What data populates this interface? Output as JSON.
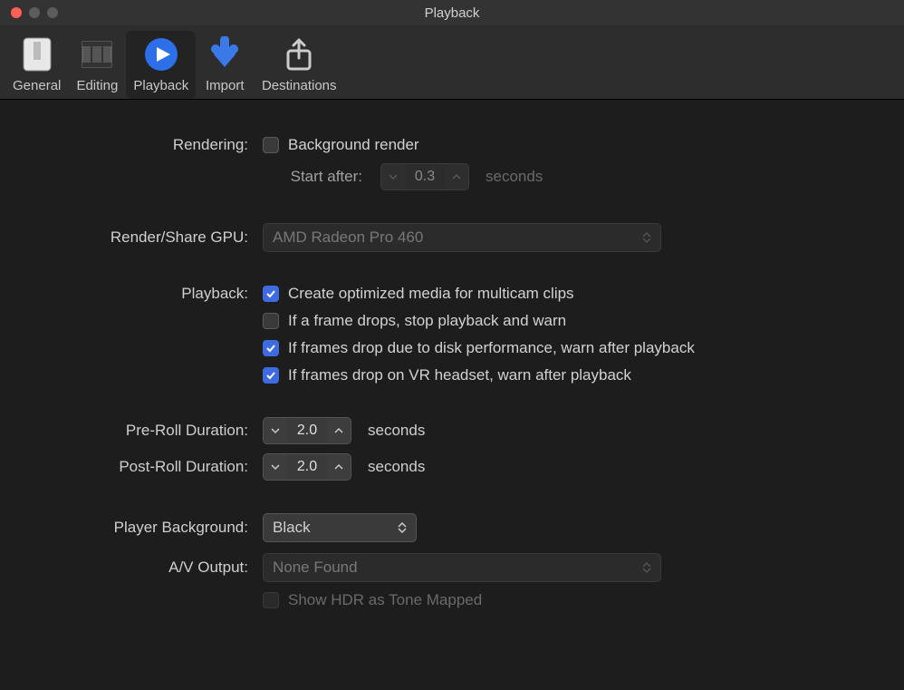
{
  "window": {
    "title": "Playback"
  },
  "toolbar": {
    "general": "General",
    "editing": "Editing",
    "playback": "Playback",
    "import": "Import",
    "destinations": "Destinations"
  },
  "labels": {
    "rendering": "Rendering:",
    "start_after": "Start after:",
    "render_share_gpu": "Render/Share GPU:",
    "playback": "Playback:",
    "pre_roll": "Pre-Roll Duration:",
    "post_roll": "Post-Roll Duration:",
    "player_bg": "Player Background:",
    "av_output": "A/V Output:"
  },
  "checkboxes": {
    "background_render": "Background render",
    "opt_multicam": "Create optimized media for multicam clips",
    "frame_drop_stop": "If a frame drops, stop playback and warn",
    "disk_warn": "If frames drop due to disk performance, warn after playback",
    "vr_warn": "If frames drop on VR headset, warn after playback",
    "hdr_tone": "Show HDR as Tone Mapped"
  },
  "values": {
    "start_after": "0.3",
    "gpu": "AMD Radeon Pro 460",
    "pre_roll": "2.0",
    "post_roll": "2.0",
    "player_bg": "Black",
    "av_output": "None Found"
  },
  "units": {
    "seconds": "seconds"
  }
}
